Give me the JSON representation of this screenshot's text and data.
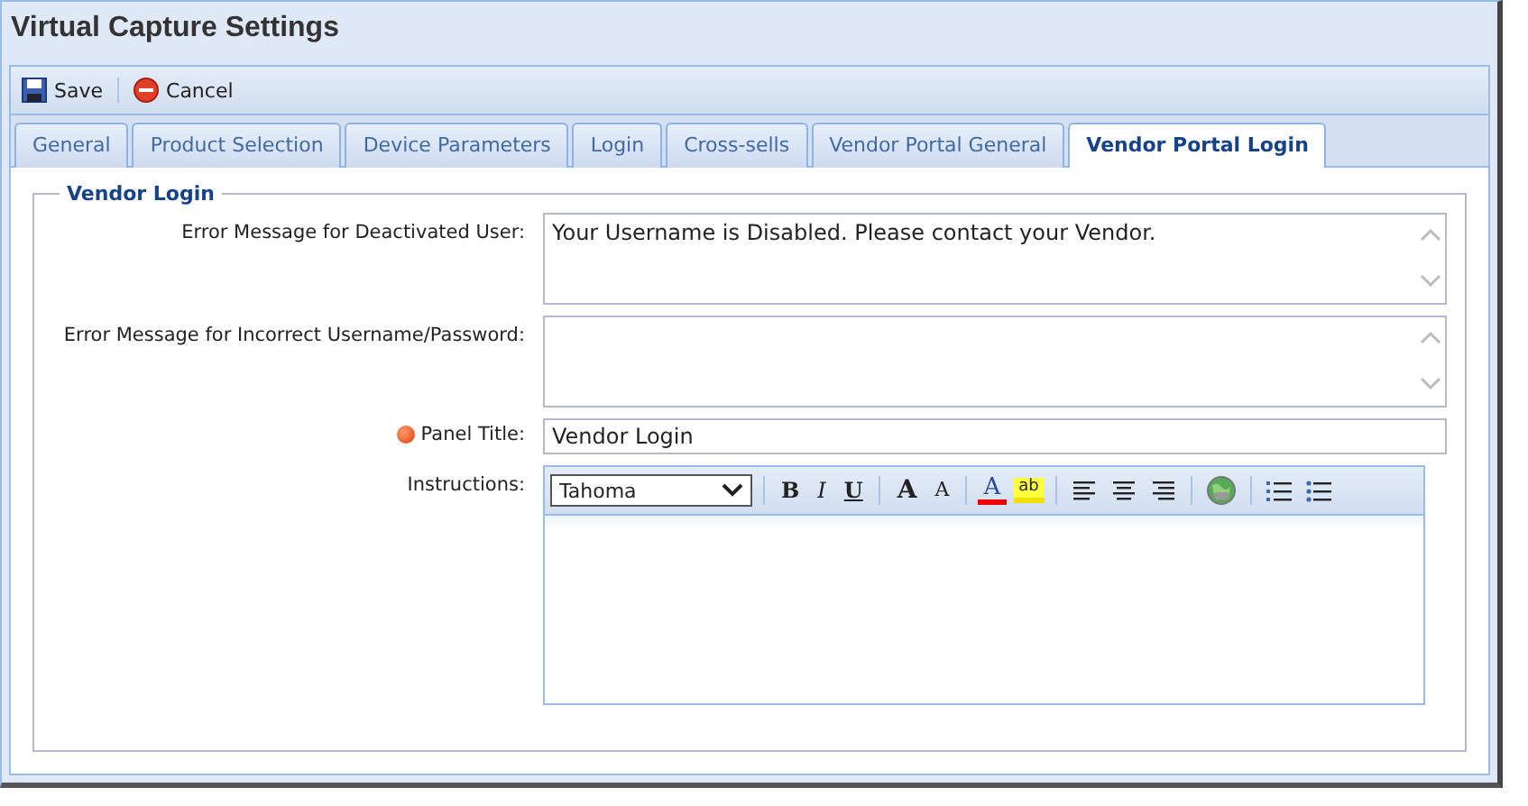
{
  "window": {
    "title": "Virtual Capture Settings"
  },
  "toolbar": [
    {
      "kind": "save",
      "label": "Save"
    },
    {
      "kind": "cancel",
      "label": "Cancel"
    }
  ],
  "tabs": [
    {
      "label": "General",
      "selected": false
    },
    {
      "label": "Product Selection",
      "selected": false
    },
    {
      "label": "Device Parameters",
      "selected": false
    },
    {
      "label": "Login",
      "selected": false
    },
    {
      "label": "Cross-sells",
      "selected": false
    },
    {
      "label": "Vendor Portal General",
      "selected": false
    },
    {
      "label": "Vendor Portal Login",
      "selected": true
    }
  ],
  "fieldset": {
    "legend": "Vendor Login",
    "fields": [
      {
        "kind": "textarea",
        "label": "Error Message for Deactivated User:",
        "value": "Your Username is Disabled. Please contact your Vendor.",
        "required": false
      },
      {
        "kind": "textarea",
        "label": "Error Message for Incorrect Username/Password:",
        "required": false
      },
      {
        "kind": "text",
        "label": "Panel Title:",
        "value": "Vendor Login",
        "required": true
      },
      {
        "kind": "editor",
        "label": "Instructions:",
        "font": "Tahoma",
        "required": false
      }
    ]
  },
  "editor_tools": [
    {
      "kind": "bold",
      "label": "B"
    },
    {
      "kind": "italic",
      "label": "I"
    },
    {
      "kind": "underline",
      "label": "U"
    },
    {
      "kind": "sep"
    },
    {
      "kind": "grow",
      "label": "A"
    },
    {
      "kind": "shrink",
      "label": "A"
    },
    {
      "kind": "sep"
    },
    {
      "kind": "fontcolor",
      "label": "A"
    },
    {
      "kind": "highlight",
      "label": "ab"
    },
    {
      "kind": "sep"
    },
    {
      "kind": "left"
    },
    {
      "kind": "center"
    },
    {
      "kind": "right"
    },
    {
      "kind": "sep"
    },
    {
      "kind": "link"
    },
    {
      "kind": "sep"
    },
    {
      "kind": "ol"
    },
    {
      "kind": "ul"
    }
  ]
}
